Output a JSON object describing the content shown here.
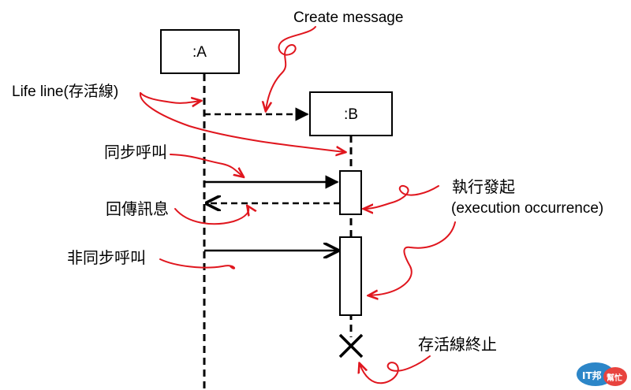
{
  "diagram": {
    "objects": [
      {
        "id": "A",
        "label": ":A"
      },
      {
        "id": "B",
        "label": ":B"
      }
    ],
    "annotations": {
      "create_message": "Create message",
      "lifeline": "Life line(存活線)",
      "sync_call": "同步呼叫",
      "return_message": "回傳訊息",
      "async_call": "非同步呼叫",
      "execution_occurrence_cn": "執行發起",
      "execution_occurrence_en": "(execution occurrence)",
      "lifeline_end": "存活線終止"
    },
    "colors": {
      "annotation": "#e0161e",
      "line": "#000000",
      "logo_blue": "#2c86c8",
      "logo_red": "#e8433e"
    },
    "logo": {
      "text_main": "IT邦",
      "text_sub": "幫忙"
    }
  }
}
